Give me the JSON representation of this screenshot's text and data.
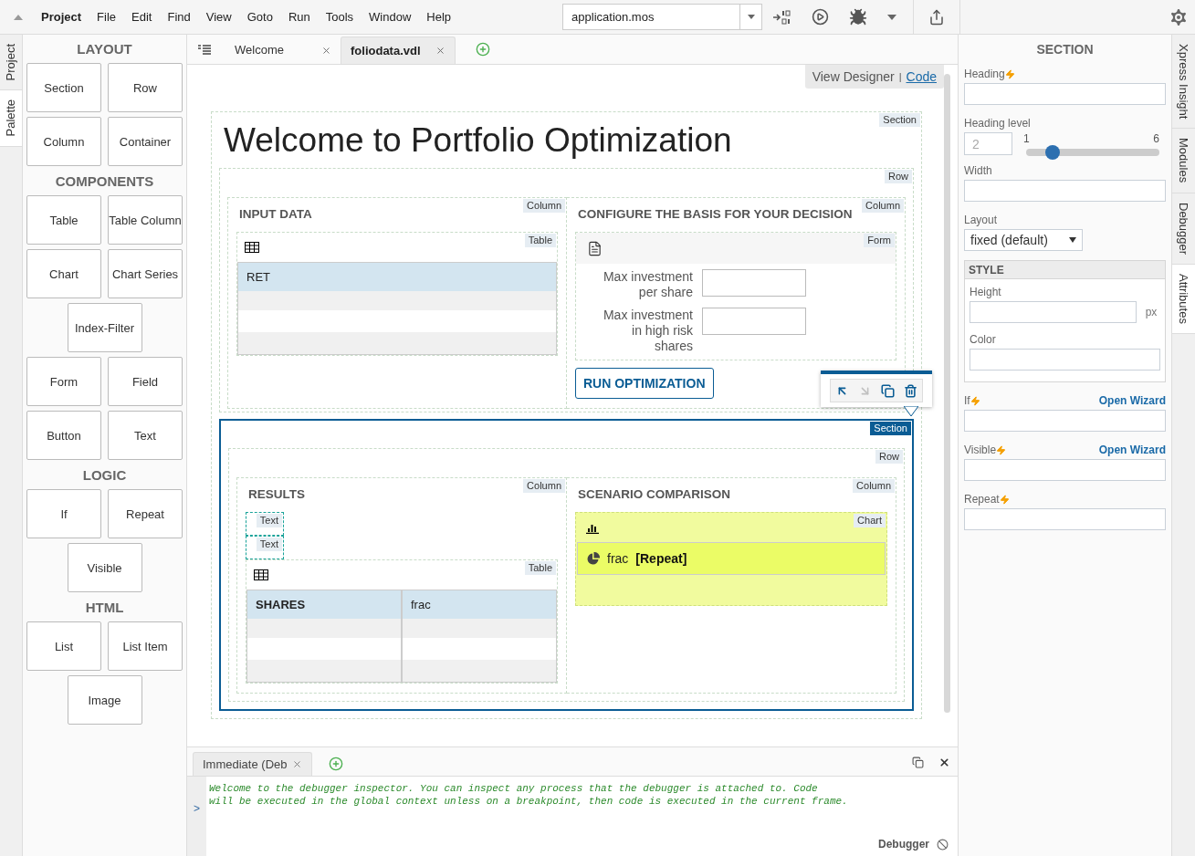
{
  "menu": {
    "items": [
      "Project",
      "File",
      "Edit",
      "Find",
      "View",
      "Goto",
      "Run",
      "Tools",
      "Window",
      "Help"
    ],
    "file": "application.mos"
  },
  "side_tabs": [
    {
      "label": "Project",
      "selected": false
    },
    {
      "label": "Palette",
      "selected": true
    }
  ],
  "palette": [
    {
      "title": "LAYOUT",
      "rows": [
        [
          "Section",
          "Row"
        ],
        [
          "Column",
          "Container"
        ]
      ]
    },
    {
      "title": "COMPONENTS",
      "rows": [
        [
          "Table",
          "Table Column"
        ],
        [
          "Chart",
          "Chart Series"
        ],
        [
          "Index-Filter"
        ],
        [
          "Form",
          "Field"
        ],
        [
          "Button",
          "Text"
        ]
      ]
    },
    {
      "title": "LOGIC",
      "rows": [
        [
          "If",
          "Repeat"
        ],
        [
          "Visible"
        ]
      ]
    },
    {
      "title": "HTML",
      "rows": [
        [
          "List",
          "List Item"
        ],
        [
          "Image"
        ]
      ]
    }
  ],
  "editor_tabs": [
    {
      "label": "Welcome",
      "selected": false
    },
    {
      "label": "foliodata.vdl",
      "selected": true
    }
  ],
  "view_switch": {
    "separator": "|",
    "options": [
      {
        "label": "View Designer",
        "selected": true
      },
      {
        "label": "Code",
        "selected": false
      }
    ]
  },
  "page": {
    "tag": "Section",
    "heading": "Welcome to Portfolio Optimization",
    "blocks": [
      {
        "kind": "row",
        "tag": "Row",
        "columns": [
          {
            "tag": "Column",
            "heading": "INPUT DATA",
            "items": [
              {
                "kind": "table",
                "tag": "Table",
                "columns": [
                  {
                    "label": "RET",
                    "bold": false
                  }
                ]
              }
            ]
          },
          {
            "tag": "Column",
            "heading": "CONFIGURE THE BASIS FOR YOUR DECISION",
            "items": [
              {
                "kind": "form",
                "tag": "Form",
                "fields": [
                  "Max investment per share",
                  "Max investment in high risk shares"
                ]
              },
              {
                "kind": "button",
                "label": "RUN OPTIMIZATION"
              }
            ]
          }
        ]
      },
      {
        "kind": "section",
        "tag": "Section",
        "selected": true,
        "toolbar": [
          {
            "kind": "parent",
            "disabled": false
          },
          {
            "kind": "child",
            "disabled": true
          },
          {
            "kind": "copy",
            "disabled": false
          },
          {
            "kind": "delete",
            "disabled": false
          }
        ],
        "row": {
          "tag": "Row",
          "columns": [
            {
              "tag": "Column",
              "heading": "RESULTS",
              "items": [
                {
                  "kind": "text",
                  "tag": "Text"
                },
                {
                  "kind": "text",
                  "tag": "Text"
                },
                {
                  "kind": "table",
                  "tag": "Table",
                  "columns": [
                    {
                      "label": "SHARES",
                      "bold": true
                    },
                    {
                      "label": "frac",
                      "bold": false
                    }
                  ]
                }
              ]
            },
            {
              "tag": "Column",
              "heading": "SCENARIO COMPARISON",
              "items": [
                {
                  "kind": "chart",
                  "tag": "Chart",
                  "series": [
                    {
                      "name": "frac",
                      "note": "[Repeat]"
                    }
                  ]
                }
              ]
            }
          ]
        }
      }
    ]
  },
  "properties": {
    "title": "SECTION",
    "fields": [
      {
        "kind": "text",
        "label": "Heading",
        "dynamic": true
      },
      {
        "kind": "level",
        "label": "Heading level",
        "placeholder": "2",
        "min": "1",
        "max": "6",
        "level": 0.2
      },
      {
        "kind": "text",
        "label": "Width",
        "dynamic": false
      },
      {
        "kind": "select",
        "label": "Layout",
        "value": "fixed (default)"
      },
      {
        "kind": "group",
        "title": "STYLE",
        "fields": [
          {
            "kind": "unit",
            "label": "Height",
            "unit": "px"
          },
          {
            "kind": "text",
            "label": "Color",
            "dynamic": false
          }
        ]
      },
      {
        "kind": "text",
        "label": "If",
        "dynamic": true,
        "wizard": "Open Wizard"
      },
      {
        "kind": "text",
        "label": "Visible",
        "dynamic": true,
        "wizard": "Open Wizard"
      },
      {
        "kind": "text",
        "label": "Repeat",
        "dynamic": true
      }
    ]
  },
  "right_tabs": [
    {
      "label": "Xpress Insight",
      "selected": false
    },
    {
      "label": "Modules",
      "selected": false
    },
    {
      "label": "Debugger",
      "selected": false
    },
    {
      "label": "Attributes",
      "selected": true
    }
  ],
  "console": {
    "tabs": [
      {
        "label": "Immediate (Deb",
        "selected": true
      }
    ],
    "lines": [
      "Welcome to the debugger inspector. You can inspect any process that the debugger is attached to. Code",
      "will be executed in the global context unless on a breakpoint, then code is executed in the current frame."
    ],
    "prompt": ">",
    "footer": "Debugger"
  }
}
